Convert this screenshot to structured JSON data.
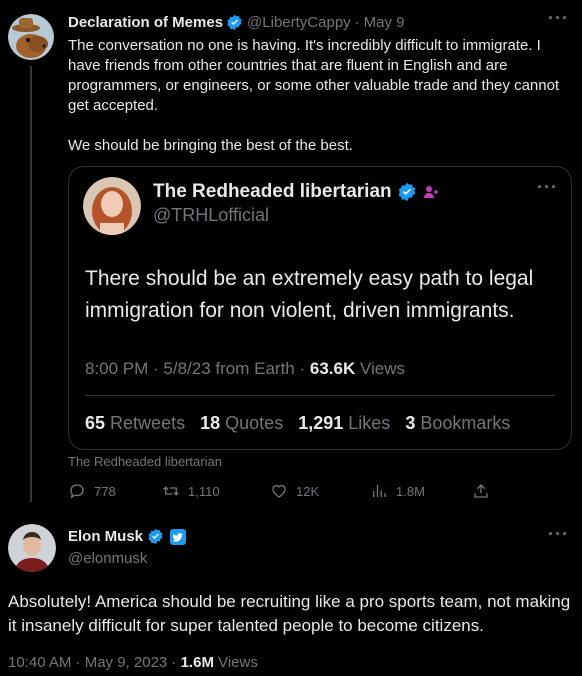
{
  "tweet": {
    "author_name": "Declaration of Memes",
    "handle": "@LibertyCappy",
    "separator": "·",
    "date": "May 9",
    "more": "···",
    "text": "The conversation no one is having. It's incredibly difficult to immigrate. I have friends from other countries that are fluent in English and are programmers, or engineers, or some other valuable trade and they cannot get accepted.\n\nWe should be bringing the best of the best."
  },
  "quote": {
    "author_name": "The Redheaded libertarian",
    "handle": "@TRHLofficial",
    "more": "···",
    "text": "There should be an extremely easy path to legal immigration for non violent, driven immigrants.",
    "time": "8:00 PM · 5/8/23 from Earth · ",
    "views_count": "63.6K",
    "views_label": " Views",
    "stats": [
      {
        "count": "65",
        "label": "Retweets"
      },
      {
        "count": "18",
        "label": "Quotes"
      },
      {
        "count": "1,291",
        "label": "Likes"
      },
      {
        "count": "3",
        "label": "Bookmarks"
      }
    ]
  },
  "attribution": "The Redheaded libertarian",
  "actions": {
    "replies": "778",
    "retweets": "1,110",
    "likes": "12K",
    "views": "1.8M"
  },
  "reply": {
    "author_name": "Elon Musk",
    "handle": "@elonmusk",
    "more": "···",
    "text": "Absolutely! America should be recruiting like a pro sports team, not making it insanely difficult for super talented people to become citizens.",
    "time": "10:40 AM · May 9, 2023 · ",
    "views_count": "1.6M",
    "views_label": " Views"
  },
  "colors": {
    "background": "#000000",
    "text": "#e7e9ea",
    "muted": "#71767b",
    "verified": "#1d9bf0",
    "border": "#2f3336",
    "badge_pink": "#e0245e"
  }
}
